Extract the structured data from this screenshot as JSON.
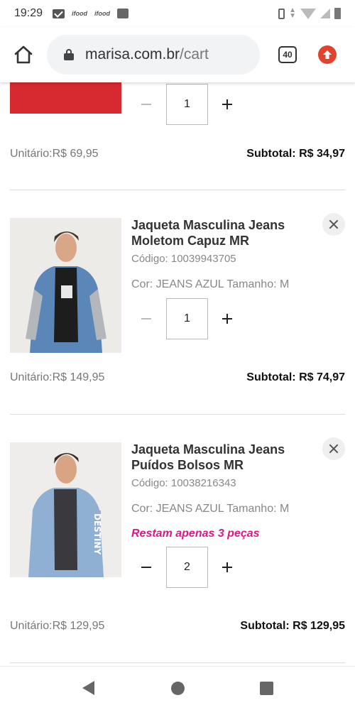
{
  "status_bar": {
    "time": "19:29",
    "icons": [
      "gmail-icon",
      "ifood-icon",
      "ifood-icon",
      "app-icon",
      "vibrate-icon",
      "data-arrows-icon",
      "wifi-icon",
      "signal-icon",
      "battery-icon"
    ],
    "ifood_label": "ifood"
  },
  "browser": {
    "url_domain": "marisa.com.br",
    "url_path": "/cart",
    "tab_count": "40",
    "accent_color": "#e0442f"
  },
  "cart": {
    "partial_item": {
      "quantity": "1",
      "unit_price": "Unitário:R$ 69,95",
      "subtotal": "Subtotal: R$ 34,97"
    },
    "items": [
      {
        "name": "Jaqueta Masculina Jeans Moletom Capuz MR",
        "code": "Código: 10039943705",
        "attributes": "Cor: JEANS AZUL Tamanho: M",
        "stock_warning": "",
        "quantity": "1",
        "unit_price": "Unitário:R$ 149,95",
        "subtotal": "Subtotal: R$ 74,97"
      },
      {
        "name": "Jaqueta Masculina Jeans Puídos Bolsos MR",
        "code": "Código: 10038216343",
        "attributes": "Cor: JEANS AZUL Tamanho: M",
        "stock_warning": "Restam apenas 3 peças",
        "quantity": "2",
        "unit_price": "Unitário:R$ 129,95",
        "subtotal": "Subtotal: R$ 129,95",
        "print_text": "DESTINY"
      }
    ],
    "warning_color": "#e0158b"
  },
  "nav": {
    "buttons": [
      "back-icon",
      "home-icon",
      "recents-icon"
    ]
  }
}
